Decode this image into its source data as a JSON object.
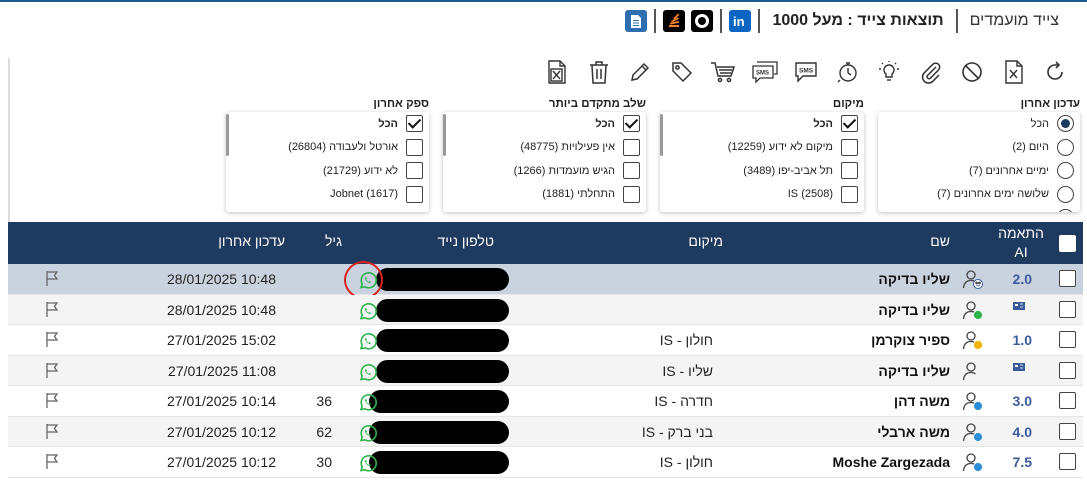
{
  "header": {
    "saved_label": "צייד מועמדים",
    "results_label": "תוצאות צייד : מעל 1000",
    "icons": [
      "linkedin-icon",
      "github-icon",
      "stackoverflow-icon",
      "document-icon"
    ]
  },
  "toolbar": {
    "buttons": [
      "refresh-icon",
      "excel-icon",
      "block-icon",
      "attach-icon",
      "idea-icon",
      "timer-icon",
      "sms-icon",
      "sms-bulk-icon",
      "cart-icon",
      "tag-icon",
      "edit-icon",
      "trash-icon",
      "excel-export-icon"
    ]
  },
  "filters": {
    "last_update": {
      "title": "עדכון אחרון",
      "options": [
        {
          "label": "הכל",
          "checked": true
        },
        {
          "label": "היום (2)",
          "checked": false
        },
        {
          "label": "ימיים אחרונים (7)",
          "checked": false
        },
        {
          "label": "שלושה ימים אחרונים (7)",
          "checked": false
        }
      ]
    },
    "location": {
      "title": "מיקום",
      "options": [
        {
          "label": "הכל",
          "checked": true,
          "bold": true
        },
        {
          "label": "מיקום לא ידוע (12259)",
          "checked": false
        },
        {
          "label": "תל אביב-יפו (3489)",
          "checked": false
        },
        {
          "label": "IS (2508)",
          "checked": false
        }
      ]
    },
    "stage": {
      "title": "שלב מתקדם ביותר",
      "options": [
        {
          "label": "הכל",
          "checked": true,
          "bold": true
        },
        {
          "label": "אין פעילויות (48775)",
          "checked": false
        },
        {
          "label": "הגיש מועמדות (1266)",
          "checked": false
        },
        {
          "label": "התחלתי (1881)",
          "checked": false
        }
      ]
    },
    "source": {
      "title": "ספק אחרון",
      "options": [
        {
          "label": "הכל",
          "checked": true,
          "bold": true
        },
        {
          "label": "אורטל ולעבודה (26804)",
          "checked": false
        },
        {
          "label": "לא ידוע (21729)",
          "checked": false
        },
        {
          "label": "Jobnet (1617)",
          "checked": false
        }
      ]
    }
  },
  "table": {
    "headers": {
      "ai_match": "התאמה AI",
      "name": "שם",
      "location": "מיקום",
      "phone": "טלפון נייד",
      "age": "גיל",
      "last_update": "עדכון אחרון"
    },
    "rows": [
      {
        "score": "2.0",
        "name": "שליו בדיקה",
        "location": "",
        "age": "",
        "date": "28/01/2025 10:48",
        "status": "face-icon",
        "highlighted": true
      },
      {
        "score": "",
        "name": "שליו בדיקה",
        "location": "",
        "age": "",
        "date": "28/01/2025 10:48",
        "status": "green-dot",
        "highlighted": false,
        "flag_cell": true
      },
      {
        "score": "1.0",
        "name": "ספיר צוקרמן",
        "location": "IS - חולון",
        "age": "",
        "date": "27/01/2025 15:02",
        "status": "yellow-dot",
        "highlighted": false
      },
      {
        "score": "",
        "name": "שליו בדיקה",
        "location": "IS - שליו",
        "age": "",
        "date": "27/01/2025 11:08",
        "status": "plain",
        "highlighted": false,
        "flag_cell": true
      },
      {
        "score": "3.0",
        "name": "משה דהן",
        "location": "IS - חדרה",
        "age": "36",
        "date": "27/01/2025 10:14",
        "status": "blue-dot",
        "highlighted": false
      },
      {
        "score": "4.0",
        "name": "משה ארבלי",
        "location": "IS - בני ברק",
        "age": "62",
        "date": "27/01/2025 10:12",
        "status": "blue-dot",
        "highlighted": false
      },
      {
        "score": "7.5",
        "name": "Moshe Zargezada",
        "location": "IS - חולון",
        "age": "30",
        "date": "27/01/2025 10:12",
        "status": "blue-dot",
        "highlighted": false
      }
    ]
  },
  "colors": {
    "header_bg": "#1f3a5f",
    "score": "#3b5a9a",
    "whatsapp": "#2bb34a",
    "highlight": "#c9d3df",
    "annotation": "#d9221f"
  }
}
